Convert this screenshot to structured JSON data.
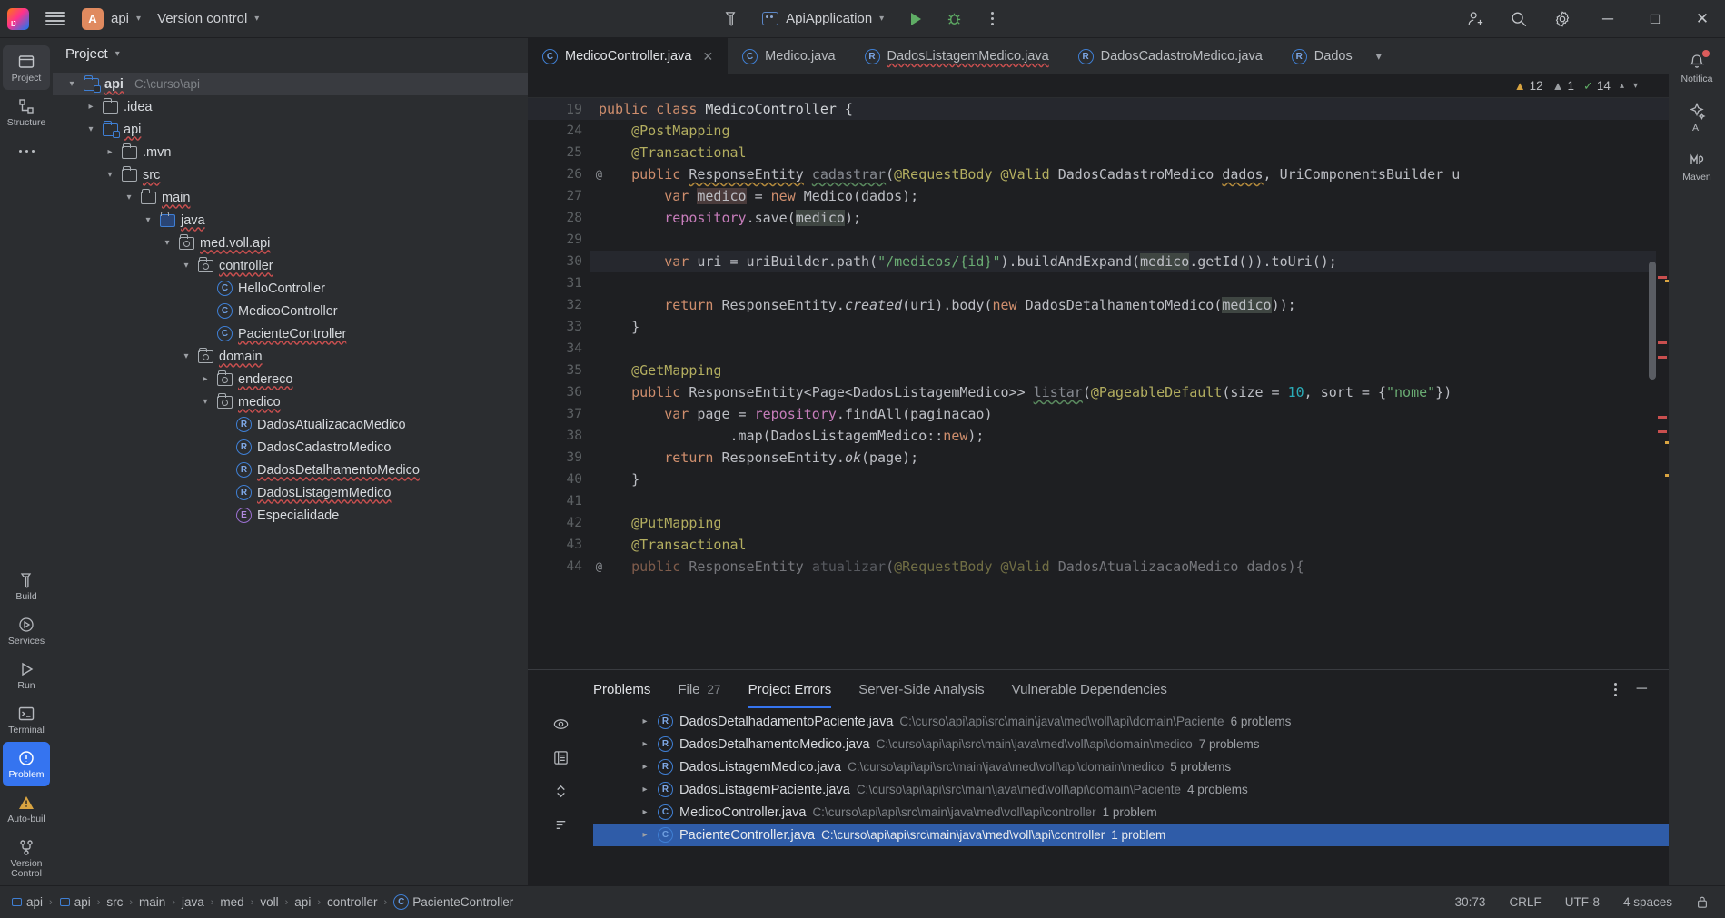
{
  "topbar": {
    "logo_icon": "intellij-logo",
    "menu_icon": "hamburger-menu-icon",
    "project_badge": "A",
    "project_name": "api",
    "version_control": "Version control",
    "build_icon": "hammer-icon",
    "run_config": "ApiApplication",
    "run_icon": "run-triangle-icon",
    "debug_icon": "debug-bug-icon",
    "more_icon": "kebab-menu-icon",
    "account_icon": "add-user-icon",
    "search_icon": "search-icon",
    "settings_icon": "gear-icon",
    "minimize": "─",
    "maximize": "□",
    "close": "✕"
  },
  "left_rail": [
    {
      "label": "Project",
      "icon": "project-folder-icon",
      "active": true
    },
    {
      "label": "Structure",
      "icon": "structure-icon",
      "active": false
    },
    {
      "label": "More",
      "icon": "ellipsis-icon",
      "active": false
    },
    {
      "label": "Build",
      "icon": "build-hammer-icon",
      "active": false
    },
    {
      "label": "Services",
      "icon": "services-icon",
      "active": false
    },
    {
      "label": "Run",
      "icon": "run-icon",
      "active": false
    },
    {
      "label": "Terminal",
      "icon": "terminal-icon",
      "active": false
    },
    {
      "label": "Problem",
      "icon": "problems-icon",
      "active": true
    },
    {
      "label": "Auto-buil",
      "icon": "warning-triangle-icon",
      "active": false
    },
    {
      "label": "Version Control",
      "icon": "branch-icon",
      "active": false
    }
  ],
  "project_panel": {
    "title": "Project",
    "tree": [
      {
        "indent": 0,
        "arrow": "down",
        "icon": "module-folder-icon",
        "label": "api",
        "path": "C:\\curso\\api",
        "selected": true,
        "squiggle": true,
        "bold": true
      },
      {
        "indent": 1,
        "arrow": "right",
        "icon": "folder-icon",
        "label": ".idea",
        "path": "",
        "selected": false,
        "squiggle": false
      },
      {
        "indent": 1,
        "arrow": "down",
        "icon": "module-folder-icon",
        "label": "api",
        "path": "",
        "selected": false,
        "squiggle": true
      },
      {
        "indent": 2,
        "arrow": "right",
        "icon": "folder-icon",
        "label": ".mvn",
        "path": "",
        "selected": false,
        "squiggle": false
      },
      {
        "indent": 2,
        "arrow": "down",
        "icon": "folder-icon",
        "label": "src",
        "path": "",
        "selected": false,
        "squiggle": true
      },
      {
        "indent": 3,
        "arrow": "down",
        "icon": "folder-icon",
        "label": "main",
        "path": "",
        "selected": false,
        "squiggle": true
      },
      {
        "indent": 4,
        "arrow": "down",
        "icon": "source-folder-icon",
        "label": "java",
        "path": "",
        "selected": false,
        "squiggle": true
      },
      {
        "indent": 5,
        "arrow": "down",
        "icon": "package-icon",
        "label": "med.voll.api",
        "path": "",
        "selected": false,
        "squiggle": true
      },
      {
        "indent": 6,
        "arrow": "down",
        "icon": "package-icon",
        "label": "controller",
        "path": "",
        "selected": false,
        "squiggle": true
      },
      {
        "indent": 7,
        "arrow": "none",
        "icon": "java-class-icon",
        "label": "HelloController",
        "path": "",
        "selected": false,
        "squiggle": false
      },
      {
        "indent": 7,
        "arrow": "none",
        "icon": "java-class-icon",
        "label": "MedicoController",
        "path": "",
        "selected": false,
        "squiggle": false
      },
      {
        "indent": 7,
        "arrow": "none",
        "icon": "java-class-icon",
        "label": "PacienteController",
        "path": "",
        "selected": false,
        "squiggle": true
      },
      {
        "indent": 6,
        "arrow": "down",
        "icon": "package-icon",
        "label": "domain",
        "path": "",
        "selected": false,
        "squiggle": true
      },
      {
        "indent": 7,
        "arrow": "right",
        "icon": "package-icon",
        "label": "endereco",
        "path": "",
        "selected": false,
        "squiggle": true
      },
      {
        "indent": 7,
        "arrow": "down",
        "icon": "package-icon",
        "label": "medico",
        "path": "",
        "selected": false,
        "squiggle": true
      },
      {
        "indent": 8,
        "arrow": "none",
        "icon": "java-record-icon",
        "label": "DadosAtualizacaoMedico",
        "path": "",
        "selected": false,
        "squiggle": false
      },
      {
        "indent": 8,
        "arrow": "none",
        "icon": "java-record-icon",
        "label": "DadosCadastroMedico",
        "path": "",
        "selected": false,
        "squiggle": false
      },
      {
        "indent": 8,
        "arrow": "none",
        "icon": "java-record-icon",
        "label": "DadosDetalhamentoMedico",
        "path": "",
        "selected": false,
        "squiggle": true
      },
      {
        "indent": 8,
        "arrow": "none",
        "icon": "java-record-icon",
        "label": "DadosListagemMedico",
        "path": "",
        "selected": false,
        "squiggle": true
      },
      {
        "indent": 8,
        "arrow": "none",
        "icon": "java-enum-icon",
        "label": "Especialidade",
        "path": "",
        "selected": false,
        "squiggle": false
      }
    ]
  },
  "editor": {
    "tabs": [
      {
        "label": "MedicoController.java",
        "icon": "java-class-icon",
        "active": true,
        "closable": true,
        "squiggle": false
      },
      {
        "label": "Medico.java",
        "icon": "java-class-icon",
        "active": false,
        "closable": false,
        "squiggle": false
      },
      {
        "label": "DadosListagemMedico.java",
        "icon": "java-record-icon",
        "active": false,
        "closable": false,
        "squiggle": true
      },
      {
        "label": "DadosCadastroMedico.java",
        "icon": "java-record-icon",
        "active": false,
        "closable": false,
        "squiggle": false
      },
      {
        "label": "Dados",
        "icon": "java-record-icon",
        "active": false,
        "closable": false,
        "squiggle": false
      }
    ],
    "tabs_overflow_icon": "chevron-down-icon",
    "inspections": {
      "errors": "12",
      "warnings": "1",
      "checks": "14",
      "error_icon": "error-triangle-icon",
      "warning_icon": "warning-triangle-icon",
      "check_icon": "checkmark-icon",
      "up_icon": "chevron-up-icon",
      "down_icon": "chevron-down-icon"
    },
    "sticky_line_number": "19",
    "sticky_line_html": "<span class=\"kw\">public</span> <span class=\"kw\">class</span> MedicoController {",
    "lines": [
      {
        "num": "24",
        "marker": "",
        "html": "    <span class=\"ann\">@PostMapping</span>"
      },
      {
        "num": "25",
        "marker": "",
        "html": "    <span class=\"ann\">@Transactional</span>"
      },
      {
        "num": "26",
        "marker": "@",
        "html": "    <span class=\"kw\">public</span> <span class=\"uline-o\">ResponseEntity</span> <span class=\"gray uline-g\">cadastrar</span>(<span class=\"ann\">@RequestBody</span> <span class=\"ann\">@Valid</span> DadosCadastroMedico <span class=\"uline-o\">dados</span>, UriComponentsBuilder u"
      },
      {
        "num": "27",
        "marker": "",
        "html": "        <span class=\"kw\">var</span> <span class=\"hlbox\">medico</span> = <span class=\"kw\">new</span> Medico(dados);"
      },
      {
        "num": "28",
        "marker": "",
        "html": "        <span class=\"fld\">repository</span>.save(<span class=\"hlbox2\">medico</span>);"
      },
      {
        "num": "29",
        "marker": "",
        "html": ""
      },
      {
        "num": "30",
        "marker": "",
        "html": "        <span class=\"kw\">var</span> uri = uriBuilder.path(<span class=\"str\">\"/medicos/{id}\"</span>).buildAndExpand(<span class=\"hlbox2\">medico</span>.getId()).toUri();",
        "highlight": true
      },
      {
        "num": "31",
        "marker": "",
        "html": ""
      },
      {
        "num": "32",
        "marker": "",
        "html": "        <span class=\"kw\">return</span> ResponseEntity.<span class=\"ital\">created</span>(uri).body(<span class=\"kw\">new</span> DadosDetalhamentoMedico(<span class=\"hlbox2\">medico</span>));"
      },
      {
        "num": "33",
        "marker": "",
        "html": "    }"
      },
      {
        "num": "34",
        "marker": "",
        "html": ""
      },
      {
        "num": "35",
        "marker": "",
        "html": "    <span class=\"ann\">@GetMapping</span>"
      },
      {
        "num": "36",
        "marker": "",
        "html": "    <span class=\"kw\">public</span> ResponseEntity&lt;Page&lt;DadosListagemMedico&gt;&gt; <span class=\"gray uline-g\">listar</span>(<span class=\"ann\">@PageableDefault</span>(size = <span class=\"num\">10</span>, sort = {<span class=\"str\">\"nome\"</span>})"
      },
      {
        "num": "37",
        "marker": "",
        "html": "        <span class=\"kw\">var</span> page = <span class=\"fld\">repository</span>.findAll(paginacao)"
      },
      {
        "num": "38",
        "marker": "",
        "html": "                .map(DadosListagemMedico::<span class=\"kw\">new</span>);"
      },
      {
        "num": "39",
        "marker": "",
        "html": "        <span class=\"kw\">return</span> ResponseEntity.<span class=\"ital\">ok</span>(page);"
      },
      {
        "num": "40",
        "marker": "",
        "html": "    }"
      },
      {
        "num": "41",
        "marker": "",
        "html": ""
      },
      {
        "num": "42",
        "marker": "",
        "html": "    <span class=\"ann\">@PutMapping</span>"
      },
      {
        "num": "43",
        "marker": "",
        "html": "    <span class=\"ann\">@Transactional</span>"
      },
      {
        "num": "44",
        "marker": "@",
        "html": "    <span class=\"kw\">public</span> ResponseEntity <span class=\"gray\">atualizar</span>(<span class=\"ann\">@RequestBody</span> <span class=\"ann\">@Valid</span> DadosAtualizacaoMedico dados){",
        "dim": true
      }
    ]
  },
  "problems": {
    "title": "Problems",
    "tabs": [
      {
        "label": "File",
        "count": "27",
        "active": false
      },
      {
        "label": "Project Errors",
        "count": "",
        "active": true
      },
      {
        "label": "Server-Side Analysis",
        "count": "",
        "active": false
      },
      {
        "label": "Vulnerable Dependencies",
        "count": "",
        "active": false
      }
    ],
    "actions": {
      "more_icon": "kebab-menu-icon",
      "minimize_icon": "minimize-icon"
    },
    "rail_icons": [
      "eye-icon",
      "list-view-icon",
      "expand-collapse-icon",
      "sort-icon"
    ],
    "rows": [
      {
        "file": "DadosDetalhadamentoPaciente.java",
        "path": "C:\\curso\\api\\api\\src\\main\\java\\med\\voll\\api\\domain\\Paciente",
        "count": "6 problems",
        "icon": "java-record-icon",
        "selected": false
      },
      {
        "file": "DadosDetalhamentoMedico.java",
        "path": "C:\\curso\\api\\api\\src\\main\\java\\med\\voll\\api\\domain\\medico",
        "count": "7 problems",
        "icon": "java-record-icon",
        "selected": false
      },
      {
        "file": "DadosListagemMedico.java",
        "path": "C:\\curso\\api\\api\\src\\main\\java\\med\\voll\\api\\domain\\medico",
        "count": "5 problems",
        "icon": "java-record-icon",
        "selected": false
      },
      {
        "file": "DadosListagemPaciente.java",
        "path": "C:\\curso\\api\\api\\src\\main\\java\\med\\voll\\api\\domain\\Paciente",
        "count": "4 problems",
        "icon": "java-record-icon",
        "selected": false
      },
      {
        "file": "MedicoController.java",
        "path": "C:\\curso\\api\\api\\src\\main\\java\\med\\voll\\api\\controller",
        "count": "1 problem",
        "icon": "java-class-icon",
        "selected": false
      },
      {
        "file": "PacienteController.java",
        "path": "C:\\curso\\api\\api\\src\\main\\java\\med\\voll\\api\\controller",
        "count": "1 problem",
        "icon": "java-class-icon",
        "selected": true
      }
    ]
  },
  "right_rail": [
    {
      "label": "Notifica",
      "icon": "bell-icon",
      "badge": true
    },
    {
      "label": "AI",
      "icon": "ai-assistant-icon",
      "badge": false
    },
    {
      "label": "Maven",
      "icon": "maven-icon",
      "badge": false
    }
  ],
  "statusbar": {
    "crumbs": [
      {
        "label": "api",
        "icon": "module-icon"
      },
      {
        "label": "api",
        "icon": "module-icon"
      },
      {
        "label": "src",
        "icon": ""
      },
      {
        "label": "main",
        "icon": ""
      },
      {
        "label": "java",
        "icon": ""
      },
      {
        "label": "med",
        "icon": ""
      },
      {
        "label": "voll",
        "icon": ""
      },
      {
        "label": "api",
        "icon": ""
      },
      {
        "label": "controller",
        "icon": ""
      },
      {
        "label": "PacienteController",
        "icon": "java-class-icon"
      }
    ],
    "caret": "30:73",
    "line_sep": "CRLF",
    "encoding": "UTF-8",
    "indent": "4 spaces",
    "lock_icon": "lock-icon"
  },
  "colors": {
    "accent": "#3574f0",
    "bg": "#1e1f22",
    "panel": "#2b2d30",
    "selection": "#2f5ca8",
    "error": "#c94f4f",
    "warn": "#d9a441",
    "ok": "#5fad65"
  }
}
